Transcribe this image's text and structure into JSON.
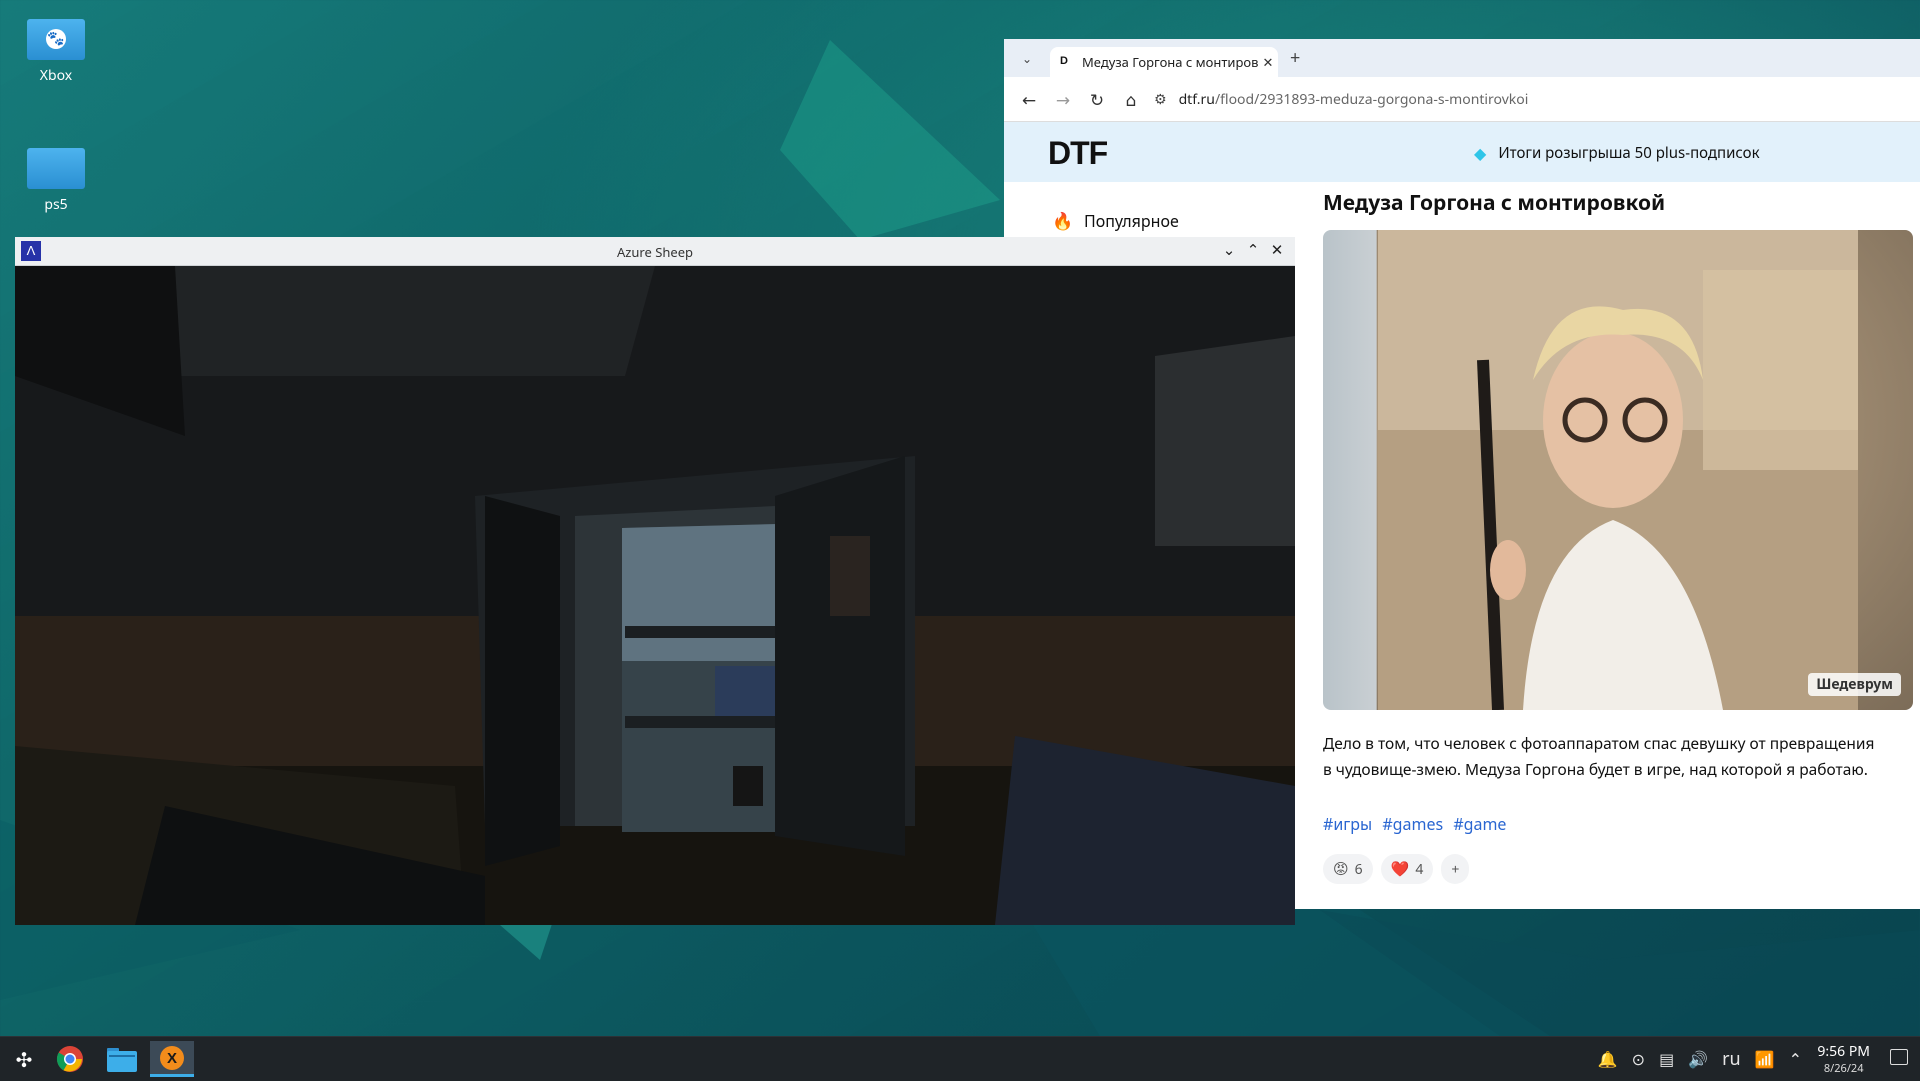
{
  "desktop": {
    "icons": [
      {
        "label": "Xbox",
        "icon": "gamepad-folder-icon"
      },
      {
        "label": "ps5",
        "icon": "folder-icon"
      }
    ]
  },
  "browser": {
    "tab": {
      "title": "Медуза Горгона с монтировкой",
      "favicon": "D"
    },
    "url": {
      "host": "dtf.ru",
      "path": "/flood/2931893-meduza-gorgona-s-montirovkoi"
    },
    "site": {
      "logo": "DTF",
      "promo": "Итоги розыгрыша 50 plus-подписок",
      "sidebar_item": "Популярное"
    },
    "post": {
      "title": "Медуза Горгона с монтировкой",
      "image_watermark": "Шедеврум",
      "text": "Дело в том, что человек с фотоаппаратом спас девушку от превращения в чудовище-змею. Медуза Горгона будет в игре, над которой я работаю.",
      "tags": [
        "#игры",
        "#games",
        "#game"
      ],
      "reactions": [
        {
          "emoji": "😡",
          "count": "6"
        },
        {
          "emoji": "❤️",
          "count": "4"
        }
      ],
      "add_reaction": "+"
    }
  },
  "game_window": {
    "title": "Azure Sheep"
  },
  "taskbar": {
    "lang": "ru",
    "time": "9:56 PM",
    "date": "8/26/24"
  }
}
